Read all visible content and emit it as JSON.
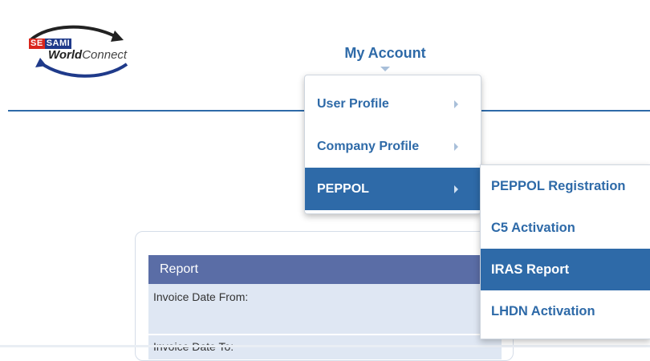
{
  "logo": {
    "badge_part1": "SE",
    "badge_part2": "SAMI",
    "name_part1": "World",
    "name_part2": "Connect",
    "colors": {
      "red": "#d9261c",
      "blue": "#1f3a8a"
    }
  },
  "nav": {
    "my_account": "My Account"
  },
  "menu": {
    "items": [
      {
        "label": "User Profile",
        "active": false
      },
      {
        "label": "Company Profile",
        "active": false
      },
      {
        "label": "PEPPOL",
        "active": true
      }
    ]
  },
  "submenu": {
    "items": [
      {
        "label": "PEPPOL Registration",
        "active": false
      },
      {
        "label": "C5 Activation",
        "active": false
      },
      {
        "label": "IRAS Report",
        "active": true
      },
      {
        "label": "LHDN Activation",
        "active": false
      }
    ]
  },
  "report": {
    "title": "Report",
    "field1_label": "Invoice Date From:",
    "field2_label": "Invoice Date To:"
  },
  "colors": {
    "accent": "#2e6aa8",
    "report_header": "#5a6da6",
    "report_row": "#dfe7f3"
  }
}
